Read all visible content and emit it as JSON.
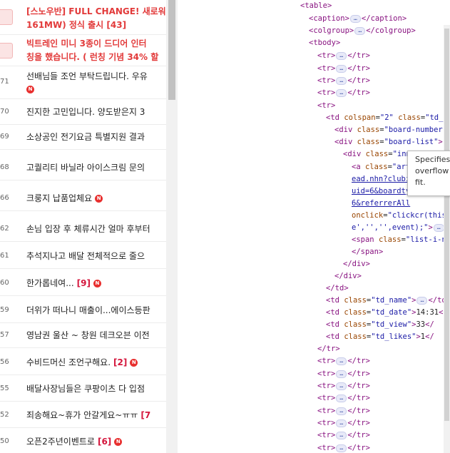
{
  "notices": [
    {
      "line1": "[스노우반] FULL CHANGE! 새로워",
      "line2": "161MW) 정식 출시 [43]"
    },
    {
      "line1": "빅트레인 미니 3종이 드디어 인터",
      "line2": "칭을 했습니다. ( 런칭 기념 34% 할"
    }
  ],
  "rows": [
    {
      "num": "71",
      "title": "선배님들 조언 부탁드립니다. 우유",
      "count": "",
      "new_badge": "N",
      "badge_next_line": true
    },
    {
      "num": "70",
      "title": "진지한 고민입니다. 양도받은지 3",
      "count": "",
      "new_badge": ""
    },
    {
      "num": "69",
      "title": "소상공인 전기요금 특별지원 결과",
      "count": "",
      "new_badge": ""
    },
    {
      "num": "68",
      "title": "고퀄리티 바닐라 아이스크림 문의",
      "count": "",
      "new_badge": ""
    },
    {
      "num": "66",
      "title": "크룽지 납품업체요",
      "count": "",
      "new_badge": "N"
    },
    {
      "num": "62",
      "title": "손님 입장 후 체류시간 얼마 후부터",
      "count": "",
      "new_badge": ""
    },
    {
      "num": "61",
      "title": "추석지나고 배달 전체적으로 줄으",
      "count": "",
      "new_badge": ""
    },
    {
      "num": "60",
      "title": "한가롭네여...",
      "count": "[9]",
      "new_badge": "N"
    },
    {
      "num": "59",
      "title": "더위가 떠나니 매출이...에이스등판",
      "count": "",
      "new_badge": ""
    },
    {
      "num": "57",
      "title": "영남권 울산 ~ 창원 데크오븐 이전",
      "count": "",
      "new_badge": ""
    },
    {
      "num": "56",
      "title": "수비드머신 조언구해요.",
      "count": "[2]",
      "new_badge": "N"
    },
    {
      "num": "55",
      "title": "배달사장님들은 쿠팡이츠 다 입점",
      "count": "",
      "new_badge": ""
    },
    {
      "num": "52",
      "title": "죄송해요~휴가 안갈게요~ㅠㅠ",
      "count": "[7",
      "new_badge": ""
    },
    {
      "num": "50",
      "title": "오픈2주년이벤트로",
      "count": "[6]",
      "new_badge": "N"
    }
  ],
  "devtools": {
    "table": "table",
    "caption": "caption",
    "colgroup": "colgroup",
    "tbody": "tbody",
    "tr": "tr",
    "td": "td",
    "div": "div",
    "a": "a",
    "span": "span",
    "attr_colspan": "colspan",
    "val_colspan": "\"2\"",
    "attr_class": "class",
    "val_td_a": "\"td_a",
    "val_board_number": "\"board-number\"",
    "val_board_list": "\"board-list\"",
    "val_inn": "\"inn",
    "val_art": "\"art",
    "href_line1": "ead.nhn?clubi",
    "href_line2": "uid=6&boardty",
    "href_line3": "6&referrerAll",
    "attr_onclick": "onclick",
    "val_onclick1": "\"clickcr(this,",
    "val_onclick2": "e','','',event);\"",
    "val_list_i": "\"list-i-ne",
    "val_td_name": "\"td_name\"",
    "val_td_date": "\"td_date\"",
    "date_text": "14:31",
    "val_td_view": "\"td_view\"",
    "view_text": "33",
    "val_td_likes": "\"td_likes\"",
    "likes_text": "1",
    "ellipsis": "…",
    "row_dots": "..."
  },
  "tooltip": {
    "line1": "Specifies",
    "line2": "overflow",
    "line3": "fit."
  },
  "icons": {
    "new_badge_color": "#e8302f",
    "count_color": "#d4163c",
    "notice_color": "#e23a3a",
    "highlight": "#cfe3fb"
  }
}
